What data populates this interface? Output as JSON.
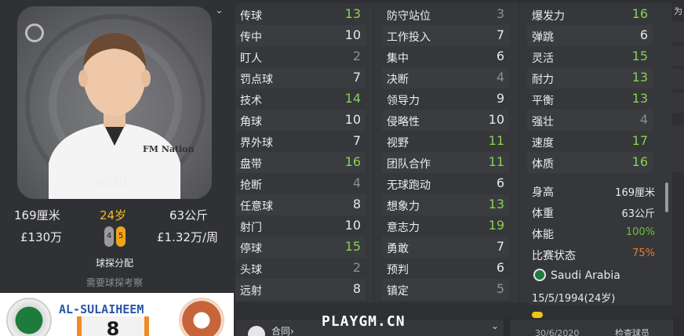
{
  "profile": {
    "name": "NONE",
    "height": "169厘米",
    "age": "24岁",
    "weight": "63公斤",
    "value": "£130万",
    "wage": "£1.32万/周",
    "left_foot": "4",
    "right_foot": "5",
    "scout_label": "球探分配",
    "scout_hint": "需要球探考察",
    "club_name": "AL-SULAIHEEM",
    "shirt_number": "8",
    "portrait_text": "FM Nation"
  },
  "attributes": {
    "technical": [
      {
        "name": "传球",
        "value": "13",
        "tier": "hi"
      },
      {
        "name": "传中",
        "value": "10",
        "tier": "mid"
      },
      {
        "name": "盯人",
        "value": "2",
        "tier": "lo"
      },
      {
        "name": "罚点球",
        "value": "7",
        "tier": "mid"
      },
      {
        "name": "技术",
        "value": "14",
        "tier": "hi"
      },
      {
        "name": "角球",
        "value": "10",
        "tier": "mid"
      },
      {
        "name": "界外球",
        "value": "7",
        "tier": "mid"
      },
      {
        "name": "盘带",
        "value": "16",
        "tier": "hi"
      },
      {
        "name": "抢断",
        "value": "4",
        "tier": "lo"
      },
      {
        "name": "任意球",
        "value": "8",
        "tier": "mid"
      },
      {
        "name": "射门",
        "value": "10",
        "tier": "mid"
      },
      {
        "name": "停球",
        "value": "15",
        "tier": "hi"
      },
      {
        "name": "头球",
        "value": "2",
        "tier": "lo"
      },
      {
        "name": "远射",
        "value": "8",
        "tier": "mid"
      }
    ],
    "mental": [
      {
        "name": "防守站位",
        "value": "3",
        "tier": "lo"
      },
      {
        "name": "工作投入",
        "value": "7",
        "tier": "mid"
      },
      {
        "name": "集中",
        "value": "6",
        "tier": "mid"
      },
      {
        "name": "决断",
        "value": "4",
        "tier": "lo"
      },
      {
        "name": "领导力",
        "value": "9",
        "tier": "mid"
      },
      {
        "name": "侵略性",
        "value": "10",
        "tier": "mid"
      },
      {
        "name": "视野",
        "value": "11",
        "tier": "hi"
      },
      {
        "name": "团队合作",
        "value": "11",
        "tier": "hi"
      },
      {
        "name": "无球跑动",
        "value": "6",
        "tier": "mid"
      },
      {
        "name": "想象力",
        "value": "13",
        "tier": "hi"
      },
      {
        "name": "意志力",
        "value": "19",
        "tier": "hi"
      },
      {
        "name": "勇敢",
        "value": "7",
        "tier": "mid"
      },
      {
        "name": "预判",
        "value": "6",
        "tier": "mid"
      },
      {
        "name": "镇定",
        "value": "5",
        "tier": "lo"
      }
    ],
    "physical": [
      {
        "name": "爆发力",
        "value": "16",
        "tier": "hi"
      },
      {
        "name": "弹跳",
        "value": "6",
        "tier": "mid"
      },
      {
        "name": "灵活",
        "value": "15",
        "tier": "hi"
      },
      {
        "name": "耐力",
        "value": "13",
        "tier": "hi"
      },
      {
        "name": "平衡",
        "value": "13",
        "tier": "hi"
      },
      {
        "name": "强壮",
        "value": "4",
        "tier": "lo"
      },
      {
        "name": "速度",
        "value": "17",
        "tier": "hi"
      },
      {
        "name": "体质",
        "value": "16",
        "tier": "hi"
      }
    ]
  },
  "info": {
    "height_label": "身高",
    "height_value": "169厘米",
    "weight_label": "体重",
    "weight_value": "63公斤",
    "fitness_label": "体能",
    "fitness_value": "100%",
    "match_label": "比赛状态",
    "match_value": "75%",
    "nation": "Saudi Arabia",
    "dob": "15/5/1994(24岁)"
  },
  "bottom": {
    "contract_label": "合同",
    "date": "30/6/2020",
    "check_label": "检查球员",
    "watermark": "PLAYGM.CN",
    "edge_label": "为"
  },
  "colors": {
    "high": "#8ad050",
    "fitness": "#6fbf3a",
    "match": "#f07b2a",
    "age": "#f5b92c"
  }
}
